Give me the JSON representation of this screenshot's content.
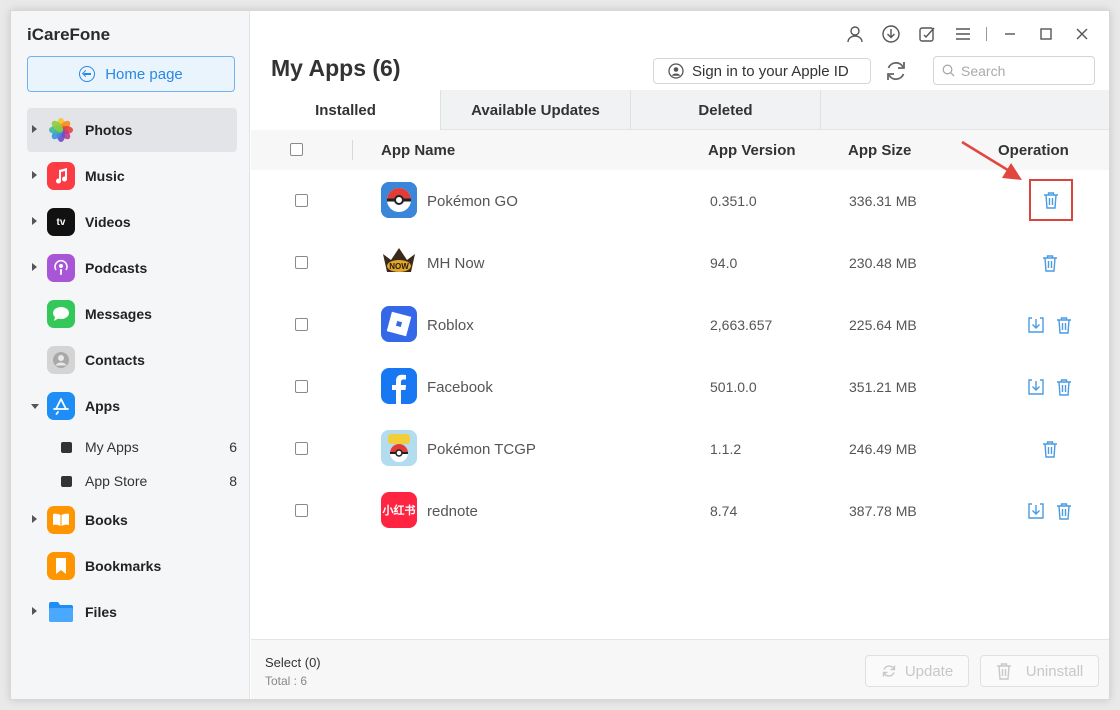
{
  "app": {
    "brand": "iCareFone",
    "home_label": "Home page"
  },
  "sidebar": {
    "items": [
      {
        "label": "Photos",
        "icon": "photos-icon",
        "color": "#ffffff",
        "caret": true,
        "active": true
      },
      {
        "label": "Music",
        "icon": "music-icon",
        "color": "#fc3c44",
        "caret": true
      },
      {
        "label": "Videos",
        "icon": "tv-icon",
        "color": "#111111",
        "caret": true
      },
      {
        "label": "Podcasts",
        "icon": "podcasts-icon",
        "color": "#a855d8",
        "caret": true
      },
      {
        "label": "Messages",
        "icon": "messages-icon",
        "color": "#34c759",
        "caret": false
      },
      {
        "label": "Contacts",
        "icon": "contacts-icon",
        "color": "#bdbdbd",
        "caret": false
      },
      {
        "label": "Apps",
        "icon": "appstore-icon",
        "color": "#1e8df5",
        "caret": true,
        "open": true
      },
      {
        "label": "Books",
        "icon": "books-icon",
        "color": "#ff9500",
        "caret": true
      },
      {
        "label": "Bookmarks",
        "icon": "bookmarks-icon",
        "color": "#ff9500",
        "caret": false
      },
      {
        "label": "Files",
        "icon": "files-icon",
        "color": "#1f8ff5",
        "caret": true
      }
    ],
    "sub_items": [
      {
        "label": "My Apps",
        "count": "6"
      },
      {
        "label": "App Store",
        "count": "8"
      }
    ]
  },
  "header": {
    "title": "My Apps (6)",
    "signin_label": "Sign in to your Apple ID",
    "search_placeholder": "Search"
  },
  "tabs": [
    {
      "label": "Installed",
      "active": true
    },
    {
      "label": "Available Updates"
    },
    {
      "label": "Deleted"
    }
  ],
  "table": {
    "headers": {
      "name": "App Name",
      "version": "App Version",
      "size": "App Size",
      "operation": "Operation"
    },
    "rows": [
      {
        "name": "Pokémon GO",
        "version": "0.351.0",
        "size": "336.31 MB",
        "icon": "pokemon-go-icon",
        "download": false,
        "highlight": true
      },
      {
        "name": "MH Now",
        "version": "94.0",
        "size": "230.48 MB",
        "icon": "mh-now-icon",
        "download": false
      },
      {
        "name": "Roblox",
        "version": "2,663.657",
        "size": "225.64 MB",
        "icon": "roblox-icon",
        "download": true
      },
      {
        "name": "Facebook",
        "version": "501.0.0",
        "size": "351.21 MB",
        "icon": "facebook-icon",
        "download": true
      },
      {
        "name": "Pokémon TCGP",
        "version": "1.1.2",
        "size": "246.49 MB",
        "icon": "pokemon-tcgp-icon",
        "download": false
      },
      {
        "name": "rednote",
        "version": "8.74",
        "size": "387.78 MB",
        "icon": "rednote-icon",
        "icon_text": "小红书",
        "download": true
      }
    ]
  },
  "footer": {
    "select_label": "Select (0)",
    "total_label": "Total : 6",
    "update_label": "Update",
    "uninstall_label": "Uninstall"
  },
  "colors": {
    "accent": "#2a88e0",
    "highlight": "#d9443d",
    "icon_blue": "#4a9be2"
  }
}
